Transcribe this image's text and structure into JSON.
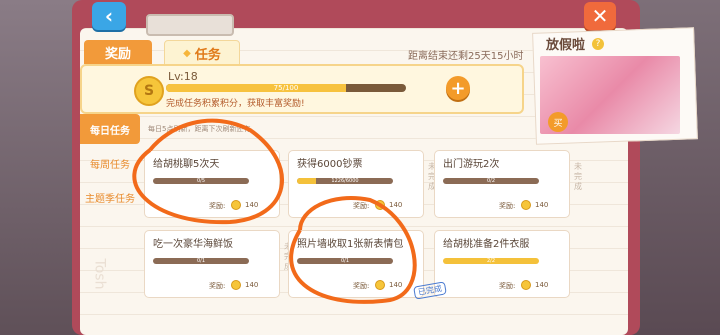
{
  "nav": {
    "back_icon": "‹",
    "close_icon": "✕"
  },
  "tabs": {
    "reward": "奖励",
    "task": "任务"
  },
  "countdown": "距离结束还剩25天15小时",
  "level": {
    "label": "Lv:18",
    "progress_text": "75/100",
    "progress": 0.75,
    "description": "完成任务积累积分，获取丰富奖励!",
    "plus": "+",
    "coin_letter": "S"
  },
  "side": {
    "daily": "每日任务",
    "weekly": "每周任务",
    "theme": "主题季任务"
  },
  "refresh_note": "每日5点刷新，距离下次刷新还有",
  "watermark": "Tosh",
  "tasks": [
    {
      "title": "给胡桃聊5次天",
      "progress_text": "0/5",
      "progress": 0,
      "reward_label": "奖励:",
      "reward": "140",
      "status": "",
      "done": false
    },
    {
      "title": "获得6000钞票",
      "progress_text": "1226/6000",
      "progress": 0.2,
      "reward_label": "奖励:",
      "reward": "140",
      "status": "未完成",
      "done": false
    },
    {
      "title": "出门游玩2次",
      "progress_text": "0/2",
      "progress": 0,
      "reward_label": "奖励:",
      "reward": "140",
      "status": "未完成",
      "done": false
    },
    {
      "title": "吃一次豪华海鲜饭",
      "progress_text": "0/1",
      "progress": 0,
      "reward_label": "奖励:",
      "reward": "140",
      "status": "未完成",
      "done": false
    },
    {
      "title": "照片墙收取1张新表情包",
      "progress_text": "0/1",
      "progress": 0,
      "reward_label": "奖励:",
      "reward": "140",
      "status": "",
      "done": false
    },
    {
      "title": "给胡桃准备2件衣服",
      "progress_text": "2/2",
      "progress": 1,
      "reward_label": "奖励:",
      "reward": "140",
      "status": "已完成",
      "done": true
    }
  ],
  "vacation": {
    "title": "放假啦",
    "q": "?",
    "buy": "买"
  },
  "colors": {
    "accent": "#f29a3a",
    "book": "#b04a5a",
    "scribble": "#f26a1a"
  }
}
